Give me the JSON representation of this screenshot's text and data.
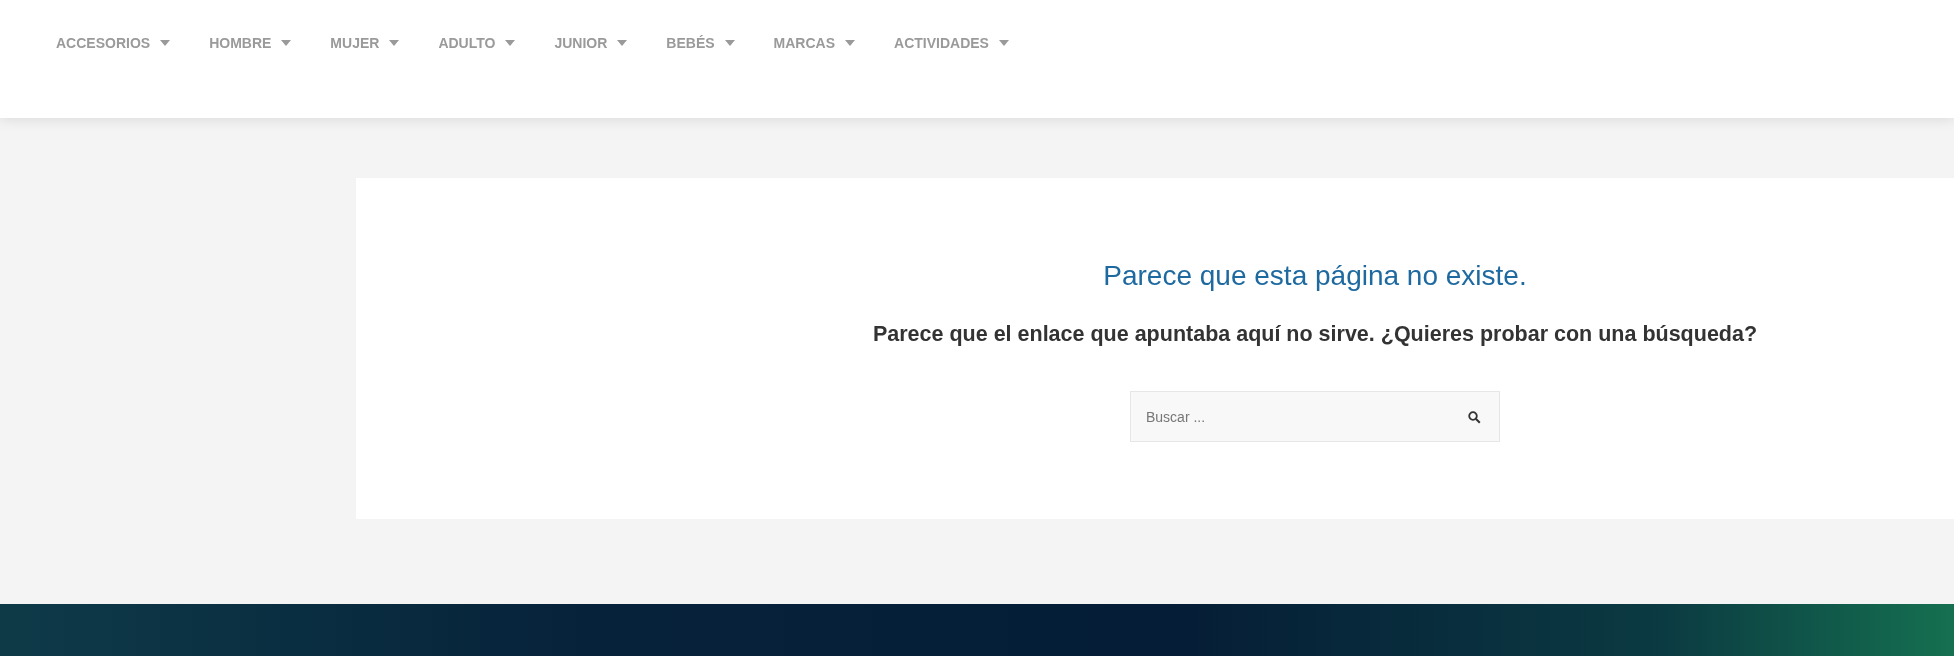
{
  "nav": {
    "items": [
      {
        "label": "ACCESORIOS"
      },
      {
        "label": "HOMBRE"
      },
      {
        "label": "MUJER"
      },
      {
        "label": "ADULTO"
      },
      {
        "label": "JUNIOR"
      },
      {
        "label": "BEBÉS"
      },
      {
        "label": "MARCAS"
      },
      {
        "label": "ACTIVIDADES"
      }
    ]
  },
  "error": {
    "title": "Parece que esta página no existe.",
    "message": "Parece que el enlace que apuntaba aquí no sirve. ¿Quieres probar con una búsqueda?"
  },
  "search": {
    "placeholder": "Buscar ..."
  }
}
